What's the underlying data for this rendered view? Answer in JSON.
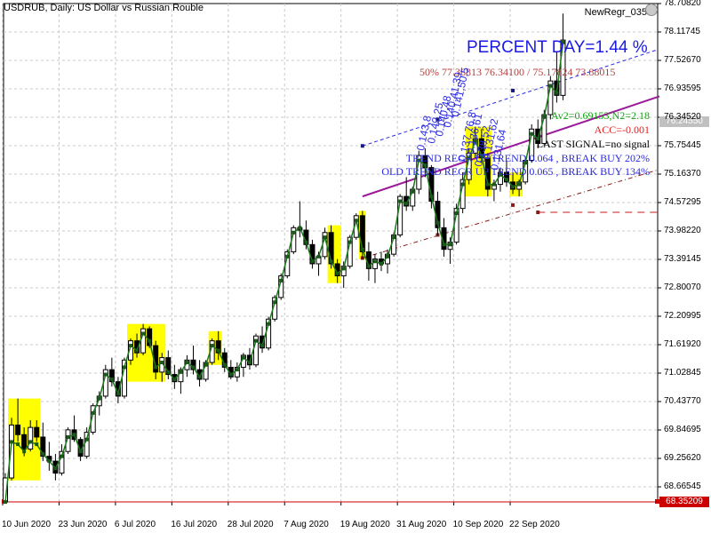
{
  "header": {
    "symbol_line": "USDRUB, Daily:  US Dollar vs Russian Rouble",
    "indicator_name": "NewRegr_035"
  },
  "annotations": {
    "percent_day": "PERCENT DAY=1.44 %",
    "levels": "50% 77.36813 76.34100 / 75.17824 73.88015",
    "av2": "Av2=0.69153,N2=2.18",
    "acc": "ACC=-0.001",
    "last_signal": "LAST SIGNAL=no signal",
    "trend_1": "TREND REGR UP TREND  0.064 , BREAK BUY 202%",
    "trend_2": "OLD TREND REGR UP TREND  0.065 , BREAK BUY 134%",
    "rotated": [
      "0.143,8",
      "0.142,25",
      "0.140,48",
      "0.140,41,39",
      "0.141,50,5",
      "0.137,76,8",
      "0.136,61",
      "0.138,52",
      "0.131,62",
      "0.131,64"
    ]
  },
  "price_tags": {
    "current": "76.24550",
    "low_line": "68.35209"
  },
  "colors": {
    "bull": "#000000",
    "bear": "#000000",
    "regression": "#1a7a1a",
    "highlight": "#ffff00",
    "channel_upper": "#2a2ae6",
    "channel_lower": "#8b1a1a",
    "trend_line": "#9a1a9a",
    "low_line": "#cc0000",
    "current_tag": "#c0c0c0",
    "grid": "#c8c8c8"
  },
  "chart_data": {
    "type": "candlestick",
    "symbol": "USDRUB",
    "timeframe": "Daily",
    "ylim": [
      68.3521,
      78.7082
    ],
    "y_ticks": [
      "78.70820",
      "78.11745",
      "77.52670",
      "76.93595",
      "76.34520",
      "75.75445",
      "75.16370",
      "74.57295",
      "73.98220",
      "73.39145",
      "72.80070",
      "72.20995",
      "71.61920",
      "71.02845",
      "70.43770",
      "69.84695",
      "69.25620",
      "68.66545"
    ],
    "x_ticks": [
      {
        "label": "10 Jun 2020",
        "index": 0
      },
      {
        "label": "23 Jun 2020",
        "index": 9
      },
      {
        "label": "6 Jul 2020",
        "index": 18
      },
      {
        "label": "16 Jul 2020",
        "index": 27
      },
      {
        "label": "28 Jul 2020",
        "index": 36
      },
      {
        "label": "7 Aug 2020",
        "index": 45
      },
      {
        "label": "19 Aug 2020",
        "index": 54
      },
      {
        "label": "31 Aug 2020",
        "index": 63
      },
      {
        "label": "10 Sep 2020",
        "index": 72
      },
      {
        "label": "22 Sep 2020",
        "index": 81
      }
    ],
    "bars": [
      [
        68.35,
        68.95,
        68.33,
        68.85
      ],
      [
        68.85,
        70.1,
        68.8,
        69.95
      ],
      [
        69.95,
        70.5,
        69.6,
        69.75
      ],
      [
        69.75,
        69.9,
        69.3,
        69.45
      ],
      [
        69.45,
        70.05,
        69.4,
        69.9
      ],
      [
        69.9,
        70.05,
        69.6,
        69.7
      ],
      [
        69.7,
        70.0,
        69.2,
        69.3
      ],
      [
        69.3,
        69.6,
        69.0,
        69.2
      ],
      [
        69.2,
        69.35,
        68.8,
        68.95
      ],
      [
        68.95,
        69.55,
        68.9,
        69.4
      ],
      [
        69.4,
        69.9,
        69.35,
        69.85
      ],
      [
        69.85,
        70.15,
        69.6,
        69.65
      ],
      [
        69.65,
        69.7,
        69.2,
        69.3
      ],
      [
        69.3,
        69.9,
        69.25,
        69.8
      ],
      [
        69.8,
        70.4,
        69.75,
        70.35
      ],
      [
        70.35,
        70.65,
        70.15,
        70.55
      ],
      [
        70.55,
        71.2,
        70.5,
        71.1
      ],
      [
        71.1,
        71.35,
        70.75,
        70.85
      ],
      [
        70.85,
        70.95,
        70.4,
        70.55
      ],
      [
        70.55,
        71.35,
        70.5,
        71.3
      ],
      [
        71.3,
        71.75,
        71.2,
        71.7
      ],
      [
        71.7,
        71.85,
        71.35,
        71.45
      ],
      [
        71.45,
        72.05,
        71.4,
        71.95
      ],
      [
        71.95,
        72.0,
        71.55,
        71.6
      ],
      [
        71.6,
        71.7,
        70.9,
        71.05
      ],
      [
        71.05,
        71.45,
        70.85,
        71.35
      ],
      [
        71.35,
        71.5,
        70.9,
        71.0
      ],
      [
        71.0,
        71.2,
        70.7,
        70.85
      ],
      [
        70.85,
        71.15,
        70.6,
        71.1
      ],
      [
        71.1,
        71.4,
        70.95,
        71.3
      ],
      [
        71.3,
        71.6,
        71.0,
        71.1
      ],
      [
        71.1,
        71.3,
        70.75,
        70.9
      ],
      [
        70.9,
        71.3,
        70.85,
        71.25
      ],
      [
        71.25,
        71.75,
        71.2,
        71.7
      ],
      [
        71.7,
        71.9,
        71.3,
        71.45
      ],
      [
        71.45,
        71.55,
        71.05,
        71.15
      ],
      [
        71.15,
        71.3,
        70.9,
        70.95
      ],
      [
        70.95,
        71.25,
        70.85,
        71.15
      ],
      [
        71.15,
        71.45,
        70.95,
        71.4
      ],
      [
        71.4,
        71.55,
        71.1,
        71.2
      ],
      [
        71.2,
        71.85,
        71.15,
        71.8
      ],
      [
        71.8,
        72.0,
        71.45,
        71.55
      ],
      [
        71.55,
        72.2,
        71.5,
        72.15
      ],
      [
        72.15,
        72.65,
        72.1,
        72.6
      ],
      [
        72.6,
        73.1,
        72.55,
        73.05
      ],
      [
        73.05,
        73.6,
        73.0,
        73.55
      ],
      [
        73.55,
        74.1,
        73.5,
        74.05
      ],
      [
        74.05,
        74.6,
        73.85,
        74.0
      ],
      [
        74.0,
        74.2,
        73.6,
        73.7
      ],
      [
        73.7,
        73.8,
        73.2,
        73.3
      ],
      [
        73.3,
        73.55,
        73.05,
        73.45
      ],
      [
        73.45,
        74.05,
        73.4,
        73.95
      ],
      [
        73.95,
        74.1,
        73.2,
        73.3
      ],
      [
        73.3,
        73.4,
        72.9,
        73.05
      ],
      [
        73.05,
        73.35,
        72.8,
        73.25
      ],
      [
        73.25,
        73.9,
        73.2,
        73.85
      ],
      [
        73.85,
        74.35,
        73.8,
        74.3
      ]
    ],
    "bars_b": [
      [
        74.3,
        74.4,
        73.4,
        73.55
      ],
      [
        73.55,
        73.75,
        72.95,
        73.2
      ],
      [
        73.2,
        73.5,
        72.9,
        73.4
      ],
      [
        73.4,
        73.55,
        73.15,
        73.3
      ],
      [
        73.3,
        73.6,
        73.1,
        73.5
      ],
      [
        73.5,
        73.95,
        73.45,
        73.9
      ],
      [
        73.9,
        74.75,
        73.85,
        74.7
      ],
      [
        74.7,
        75.1,
        74.4,
        74.5
      ],
      [
        74.5,
        74.9,
        74.4,
        74.85
      ],
      [
        74.85,
        75.65,
        74.75,
        75.55
      ],
      [
        75.55,
        75.7,
        75.1,
        75.3
      ],
      [
        75.3,
        75.35,
        74.45,
        74.6
      ],
      [
        74.6,
        74.8,
        73.9,
        74.05
      ],
      [
        74.05,
        74.25,
        73.45,
        73.6
      ],
      [
        73.6,
        73.85,
        73.3,
        73.75
      ],
      [
        73.75,
        74.55,
        73.7,
        74.45
      ],
      [
        74.45,
        75.2,
        74.35,
        75.05
      ],
      [
        75.05,
        75.7,
        74.95,
        75.6
      ],
      [
        75.6,
        76.15,
        75.5,
        75.9
      ],
      [
        75.9,
        76.1,
        75.4,
        75.5
      ],
      [
        75.5,
        75.6,
        74.7,
        74.85
      ],
      [
        74.85,
        75.05,
        74.6,
        74.95
      ],
      [
        74.95,
        75.3,
        74.8,
        75.2
      ],
      [
        75.2,
        75.45,
        74.9,
        75.0
      ],
      [
        75.0,
        75.2,
        74.75,
        74.85
      ],
      [
        74.85,
        75.05,
        74.7,
        75.0
      ],
      [
        75.0,
        75.5,
        74.95,
        75.45
      ],
      [
        75.45,
        76.2,
        75.4,
        76.1
      ],
      [
        76.1,
        76.3,
        75.7,
        75.8
      ],
      [
        75.8,
        76.5,
        75.75,
        76.4
      ],
      [
        76.4,
        77.2,
        76.3,
        77.1
      ],
      [
        77.1,
        77.7,
        76.65,
        76.8
      ],
      [
        76.8,
        78.5,
        76.7,
        77.95
      ]
    ],
    "regression_line": [
      68.35,
      69.6,
      69.55,
      69.4,
      69.6,
      69.55,
      69.35,
      69.2,
      69.05,
      69.3,
      69.7,
      69.75,
      69.4,
      69.65,
      70.2,
      70.5,
      71.0,
      70.9,
      70.6,
      71.15,
      71.6,
      71.5,
      71.85,
      71.7,
      71.15,
      71.25,
      71.05,
      70.9,
      71.05,
      71.25,
      71.15,
      70.95,
      71.2,
      71.6,
      71.5,
      71.2,
      71.0,
      71.1,
      71.35,
      71.25,
      71.7,
      71.6,
      72.05,
      72.5,
      72.95,
      73.45,
      73.95,
      74.05,
      73.75,
      73.35,
      73.45,
      73.85,
      73.35,
      73.1,
      73.2,
      73.75,
      74.2,
      73.6,
      73.25,
      73.35,
      73.3,
      73.45,
      73.85,
      74.6,
      74.55,
      74.8,
      75.45,
      75.35,
      74.7,
      74.15,
      73.7,
      73.7,
      74.35,
      74.95,
      75.5,
      75.85,
      75.55,
      74.95,
      74.95,
      75.15,
      75.05,
      74.9,
      74.95,
      75.4,
      76.0,
      75.9,
      76.35,
      77.0,
      76.85,
      77.9
    ]
  }
}
